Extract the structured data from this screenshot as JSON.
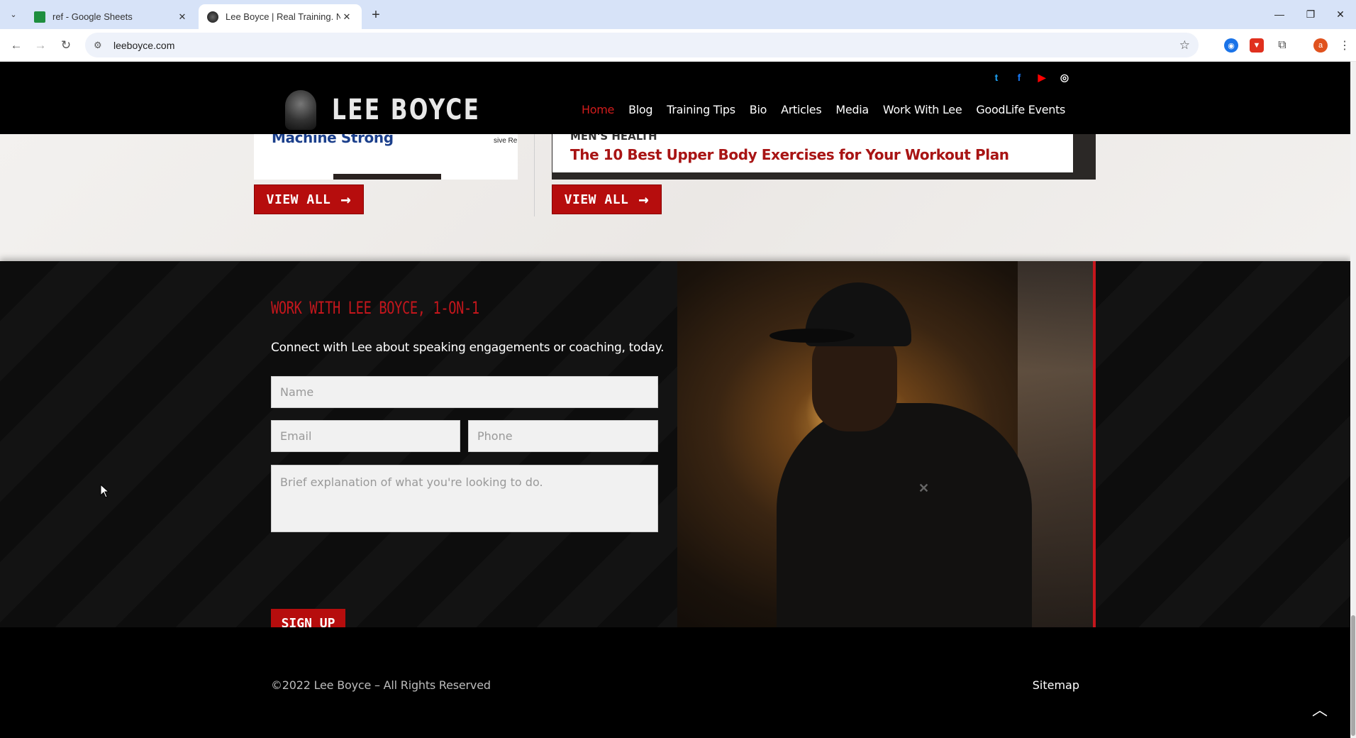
{
  "browser": {
    "tabs": [
      {
        "title": "ref - Google Sheets",
        "icon": "sheets-icon"
      },
      {
        "title": "Lee Boyce | Real Training. No N",
        "icon": "lee-boyce-favicon"
      }
    ],
    "url": "leeboyce.com"
  },
  "header": {
    "brand": "LEE BOYCE",
    "socials": [
      {
        "name": "twitter-icon",
        "glyph": "t",
        "color": "#1da1f2"
      },
      {
        "name": "facebook-icon",
        "glyph": "f",
        "color": "#1877f2"
      },
      {
        "name": "youtube-icon",
        "glyph": "▶",
        "color": "#ff0000"
      },
      {
        "name": "instagram-icon",
        "glyph": "◎",
        "color": "#ffffff"
      }
    ],
    "nav": [
      "Home",
      "Blog",
      "Training Tips",
      "Bio",
      "Articles",
      "Media",
      "Work With Lee",
      "GoodLife Events"
    ],
    "active_nav": "Home"
  },
  "articles": {
    "left_title": "Machine Strong",
    "left_promo": "sive Re BBQ Sa",
    "right_publication": "MEN'S HEALTH",
    "right_title": "The 10 Best Upper Body Exercises for Your Workout Plan",
    "view_all_label": "VIEW ALL"
  },
  "contact": {
    "heading": "WORK WITH LEE BOYCE, 1-ON-1",
    "subtitle": "Connect with Lee about speaking engagements or coaching, today.",
    "name_placeholder": "Name",
    "email_placeholder": "Email",
    "phone_placeholder": "Phone",
    "message_placeholder": "Brief explanation of what you're looking to do.",
    "submit_label": "SIGN UP"
  },
  "footer": {
    "copyright": "©2022 Lee Boyce – All Rights Reserved",
    "sitemap": "Sitemap"
  },
  "colors": {
    "accent_red": "#b60d0d",
    "link_blue": "#1b3f8b"
  }
}
